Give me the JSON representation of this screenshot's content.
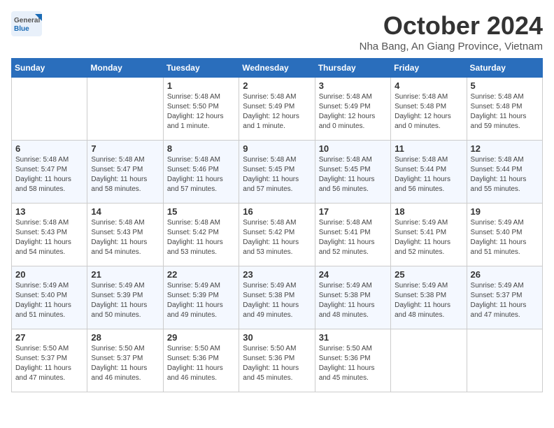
{
  "header": {
    "logo": {
      "general": "General",
      "blue": "Blue"
    },
    "title": "October 2024",
    "subtitle": "Nha Bang, An Giang Province, Vietnam"
  },
  "days_of_week": [
    "Sunday",
    "Monday",
    "Tuesday",
    "Wednesday",
    "Thursday",
    "Friday",
    "Saturday"
  ],
  "weeks": [
    [
      {
        "day": "",
        "info": ""
      },
      {
        "day": "",
        "info": ""
      },
      {
        "day": "1",
        "info": "Sunrise: 5:48 AM\nSunset: 5:50 PM\nDaylight: 12 hours\nand 1 minute."
      },
      {
        "day": "2",
        "info": "Sunrise: 5:48 AM\nSunset: 5:49 PM\nDaylight: 12 hours\nand 1 minute."
      },
      {
        "day": "3",
        "info": "Sunrise: 5:48 AM\nSunset: 5:49 PM\nDaylight: 12 hours\nand 0 minutes."
      },
      {
        "day": "4",
        "info": "Sunrise: 5:48 AM\nSunset: 5:48 PM\nDaylight: 12 hours\nand 0 minutes."
      },
      {
        "day": "5",
        "info": "Sunrise: 5:48 AM\nSunset: 5:48 PM\nDaylight: 11 hours\nand 59 minutes."
      }
    ],
    [
      {
        "day": "6",
        "info": "Sunrise: 5:48 AM\nSunset: 5:47 PM\nDaylight: 11 hours\nand 58 minutes."
      },
      {
        "day": "7",
        "info": "Sunrise: 5:48 AM\nSunset: 5:47 PM\nDaylight: 11 hours\nand 58 minutes."
      },
      {
        "day": "8",
        "info": "Sunrise: 5:48 AM\nSunset: 5:46 PM\nDaylight: 11 hours\nand 57 minutes."
      },
      {
        "day": "9",
        "info": "Sunrise: 5:48 AM\nSunset: 5:45 PM\nDaylight: 11 hours\nand 57 minutes."
      },
      {
        "day": "10",
        "info": "Sunrise: 5:48 AM\nSunset: 5:45 PM\nDaylight: 11 hours\nand 56 minutes."
      },
      {
        "day": "11",
        "info": "Sunrise: 5:48 AM\nSunset: 5:44 PM\nDaylight: 11 hours\nand 56 minutes."
      },
      {
        "day": "12",
        "info": "Sunrise: 5:48 AM\nSunset: 5:44 PM\nDaylight: 11 hours\nand 55 minutes."
      }
    ],
    [
      {
        "day": "13",
        "info": "Sunrise: 5:48 AM\nSunset: 5:43 PM\nDaylight: 11 hours\nand 54 minutes."
      },
      {
        "day": "14",
        "info": "Sunrise: 5:48 AM\nSunset: 5:43 PM\nDaylight: 11 hours\nand 54 minutes."
      },
      {
        "day": "15",
        "info": "Sunrise: 5:48 AM\nSunset: 5:42 PM\nDaylight: 11 hours\nand 53 minutes."
      },
      {
        "day": "16",
        "info": "Sunrise: 5:48 AM\nSunset: 5:42 PM\nDaylight: 11 hours\nand 53 minutes."
      },
      {
        "day": "17",
        "info": "Sunrise: 5:48 AM\nSunset: 5:41 PM\nDaylight: 11 hours\nand 52 minutes."
      },
      {
        "day": "18",
        "info": "Sunrise: 5:49 AM\nSunset: 5:41 PM\nDaylight: 11 hours\nand 52 minutes."
      },
      {
        "day": "19",
        "info": "Sunrise: 5:49 AM\nSunset: 5:40 PM\nDaylight: 11 hours\nand 51 minutes."
      }
    ],
    [
      {
        "day": "20",
        "info": "Sunrise: 5:49 AM\nSunset: 5:40 PM\nDaylight: 11 hours\nand 51 minutes."
      },
      {
        "day": "21",
        "info": "Sunrise: 5:49 AM\nSunset: 5:39 PM\nDaylight: 11 hours\nand 50 minutes."
      },
      {
        "day": "22",
        "info": "Sunrise: 5:49 AM\nSunset: 5:39 PM\nDaylight: 11 hours\nand 49 minutes."
      },
      {
        "day": "23",
        "info": "Sunrise: 5:49 AM\nSunset: 5:38 PM\nDaylight: 11 hours\nand 49 minutes."
      },
      {
        "day": "24",
        "info": "Sunrise: 5:49 AM\nSunset: 5:38 PM\nDaylight: 11 hours\nand 48 minutes."
      },
      {
        "day": "25",
        "info": "Sunrise: 5:49 AM\nSunset: 5:38 PM\nDaylight: 11 hours\nand 48 minutes."
      },
      {
        "day": "26",
        "info": "Sunrise: 5:49 AM\nSunset: 5:37 PM\nDaylight: 11 hours\nand 47 minutes."
      }
    ],
    [
      {
        "day": "27",
        "info": "Sunrise: 5:50 AM\nSunset: 5:37 PM\nDaylight: 11 hours\nand 47 minutes."
      },
      {
        "day": "28",
        "info": "Sunrise: 5:50 AM\nSunset: 5:37 PM\nDaylight: 11 hours\nand 46 minutes."
      },
      {
        "day": "29",
        "info": "Sunrise: 5:50 AM\nSunset: 5:36 PM\nDaylight: 11 hours\nand 46 minutes."
      },
      {
        "day": "30",
        "info": "Sunrise: 5:50 AM\nSunset: 5:36 PM\nDaylight: 11 hours\nand 45 minutes."
      },
      {
        "day": "31",
        "info": "Sunrise: 5:50 AM\nSunset: 5:36 PM\nDaylight: 11 hours\nand 45 minutes."
      },
      {
        "day": "",
        "info": ""
      },
      {
        "day": "",
        "info": ""
      }
    ]
  ]
}
